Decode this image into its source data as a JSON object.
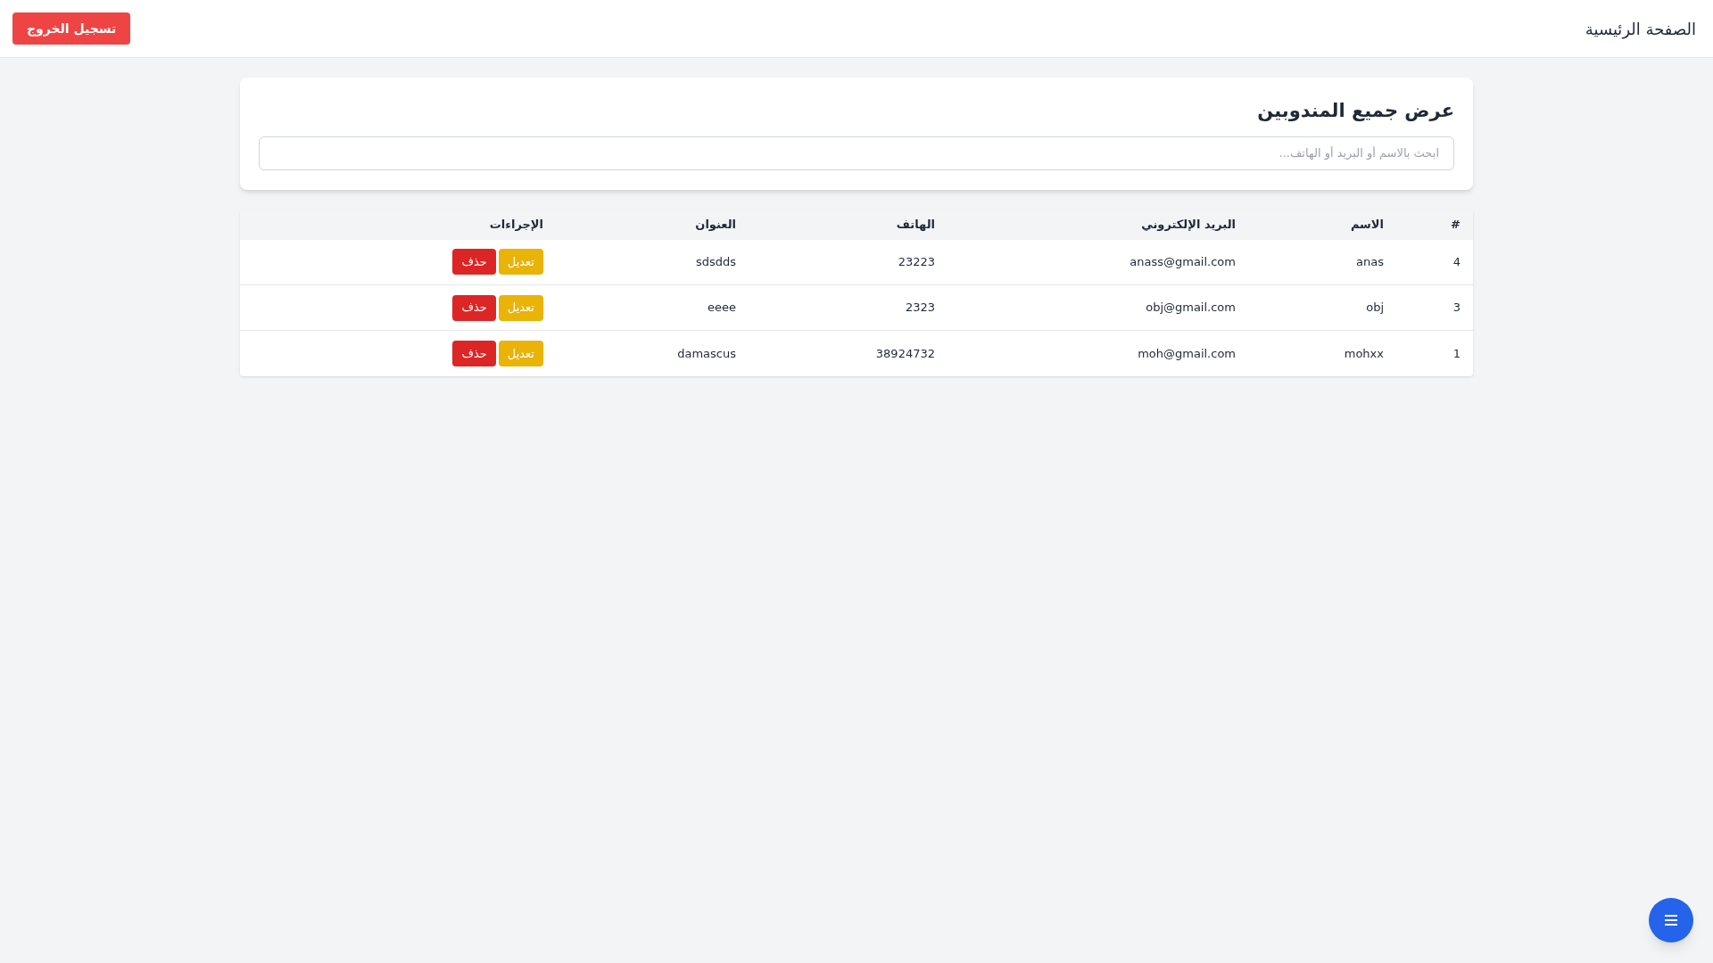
{
  "navbar": {
    "title": "الصفحة الرئيسية",
    "logout_button": "تسجيل الخروج"
  },
  "panel": {
    "title": "عرض جميع المندوبين",
    "search": {
      "placeholder": "ابحث بالاسم أو البريد أو الهاتف..."
    }
  },
  "table": {
    "columns": [
      "#",
      "الاسم",
      "البريد الإلكتروني",
      "الهاتف",
      "العنوان",
      "الإجراءات"
    ],
    "rows": [
      {
        "id": "4",
        "name": "anas",
        "email": "anass@gmail.com",
        "phone": "23223",
        "address": "sdsdds",
        "actions": [
          {
            "kind": "edit",
            "label": "تعديل"
          },
          {
            "kind": "delete",
            "label": "حذف"
          }
        ]
      },
      {
        "id": "3",
        "name": "obj",
        "email": "obj@gmail.com",
        "phone": "2323",
        "address": "eeee",
        "actions": [
          {
            "kind": "edit",
            "label": "تعديل"
          },
          {
            "kind": "delete",
            "label": "حذف"
          }
        ]
      },
      {
        "id": "1",
        "name": "mohxx",
        "email": "moh@gmail.com",
        "phone": "38924732",
        "address": "damascus",
        "actions": [
          {
            "kind": "edit",
            "label": "تعديل"
          },
          {
            "kind": "delete",
            "label": "حذف"
          }
        ]
      }
    ]
  }
}
